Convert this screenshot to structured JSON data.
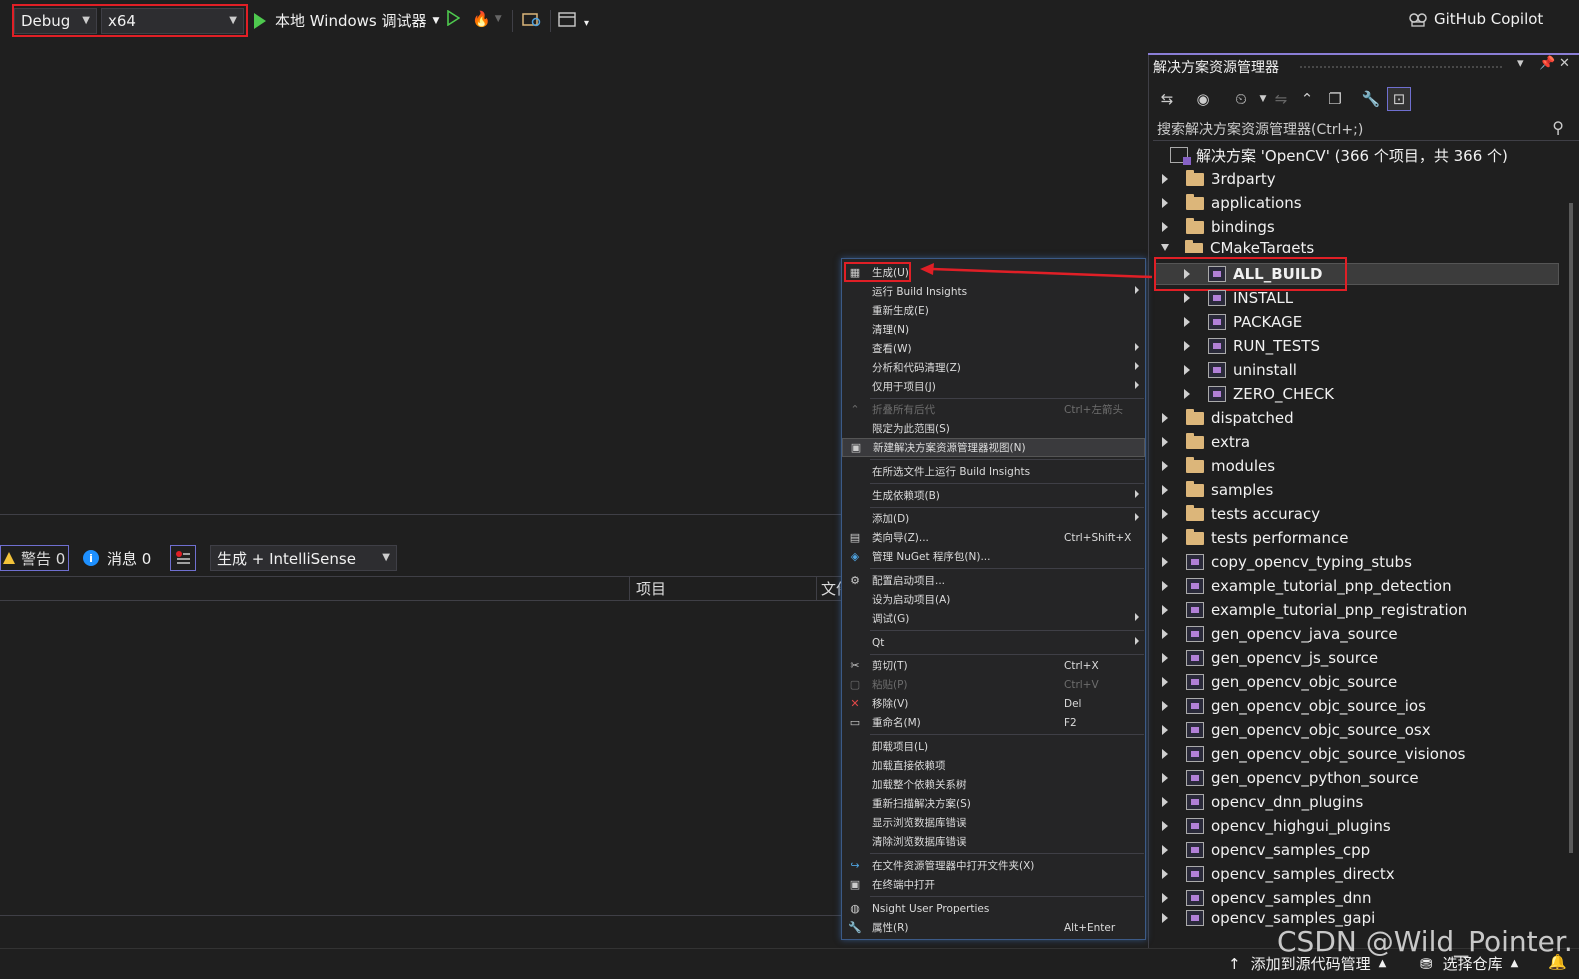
{
  "toolbar": {
    "config": "Debug",
    "platform": "x64",
    "debugger": "本地 Windows 调试器",
    "copilot": "GitHub Copilot"
  },
  "solution_explorer": {
    "title": "解决方案资源管理器",
    "search_placeholder": "搜索解决方案资源管理器(Ctrl+;)",
    "solution_label": "解决方案 'OpenCV' (366 个项目，共 366 个)",
    "top_folders": [
      "3rdparty",
      "applications",
      "bindings"
    ],
    "cmake_folder": "CMakeTargets",
    "cmake_children": [
      "ALL_BUILD",
      "INSTALL",
      "PACKAGE",
      "RUN_TESTS",
      "uninstall",
      "ZERO_CHECK"
    ],
    "more_folders": [
      "dispatched",
      "extra",
      "modules",
      "samples",
      "tests accuracy",
      "tests performance"
    ],
    "projects": [
      "copy_opencv_typing_stubs",
      "example_tutorial_pnp_detection",
      "example_tutorial_pnp_registration",
      "gen_opencv_java_source",
      "gen_opencv_js_source",
      "gen_opencv_objc_source",
      "gen_opencv_objc_source_ios",
      "gen_opencv_objc_source_osx",
      "gen_opencv_objc_source_visionos",
      "gen_opencv_python_source",
      "opencv_dnn_plugins",
      "opencv_highgui_plugins",
      "opencv_samples_cpp",
      "opencv_samples_directx",
      "opencv_samples_dnn",
      "opencv_samples_gapi"
    ]
  },
  "error_list": {
    "warnings": "警告 0",
    "messages": "消息 0",
    "scope": "生成 + IntelliSense",
    "col_project": "项目",
    "col_file": "文件"
  },
  "context_menu": {
    "items": [
      {
        "label": "生成(U)",
        "shortcut": ""
      },
      {
        "label": "运行 Build Insights",
        "shortcut": ""
      },
      {
        "label": "重新生成(E)",
        "shortcut": ""
      },
      {
        "label": "清理(N)",
        "shortcut": ""
      },
      {
        "label": "查看(W)",
        "shortcut": ""
      },
      {
        "label": "分析和代码清理(Z)",
        "shortcut": ""
      },
      {
        "label": "仅用于项目(J)",
        "shortcut": ""
      },
      {
        "label": "折叠所有后代",
        "shortcut": "Ctrl+左箭头"
      },
      {
        "label": "限定为此范围(S)",
        "shortcut": ""
      },
      {
        "label": "新建解决方案资源管理器视图(N)",
        "shortcut": ""
      },
      {
        "label": "在所选文件上运行 Build Insights",
        "shortcut": ""
      },
      {
        "label": "生成依赖项(B)",
        "shortcut": ""
      },
      {
        "label": "添加(D)",
        "shortcut": ""
      },
      {
        "label": "类向导(Z)...",
        "shortcut": "Ctrl+Shift+X"
      },
      {
        "label": "管理 NuGet 程序包(N)...",
        "shortcut": ""
      },
      {
        "label": "配置启动项目...",
        "shortcut": ""
      },
      {
        "label": "设为启动项目(A)",
        "shortcut": ""
      },
      {
        "label": "调试(G)",
        "shortcut": ""
      },
      {
        "label": "Qt",
        "shortcut": ""
      },
      {
        "label": "剪切(T)",
        "shortcut": "Ctrl+X"
      },
      {
        "label": "粘贴(P)",
        "shortcut": "Ctrl+V"
      },
      {
        "label": "移除(V)",
        "shortcut": "Del"
      },
      {
        "label": "重命名(M)",
        "shortcut": "F2"
      },
      {
        "label": "卸载项目(L)",
        "shortcut": ""
      },
      {
        "label": "加载直接依赖项",
        "shortcut": ""
      },
      {
        "label": "加载整个依赖关系树",
        "shortcut": ""
      },
      {
        "label": "重新扫描解决方案(S)",
        "shortcut": ""
      },
      {
        "label": "显示浏览数据库错误",
        "shortcut": ""
      },
      {
        "label": "清除浏览数据库错误",
        "shortcut": ""
      },
      {
        "label": "在文件资源管理器中打开文件夹(X)",
        "shortcut": ""
      },
      {
        "label": "在终端中打开",
        "shortcut": ""
      },
      {
        "label": "Nsight User Properties",
        "shortcut": ""
      },
      {
        "label": "属性(R)",
        "shortcut": "Alt+Enter"
      }
    ]
  },
  "status_bar": {
    "add_source": "添加到源代码管理",
    "select_repo": "选择仓库"
  },
  "watermark": "CSDN @Wild_Pointer.",
  "colors": {
    "highlight_red": "#e01f26",
    "accent": "#8a7ed6"
  }
}
